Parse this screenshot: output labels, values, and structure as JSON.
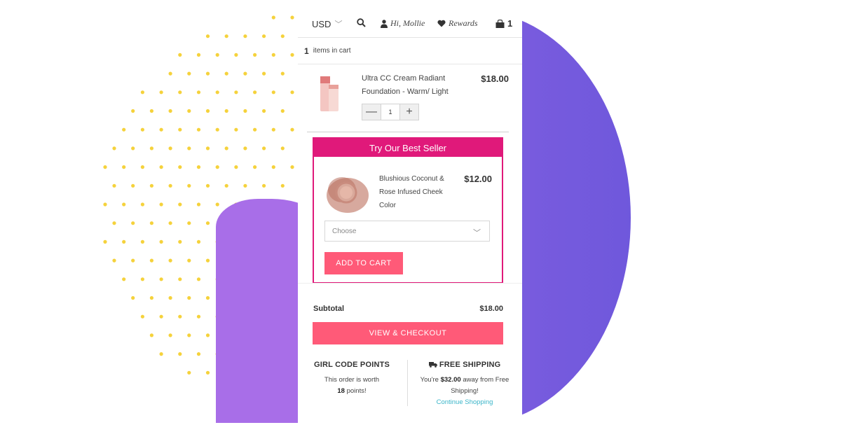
{
  "topbar": {
    "currency": "USD",
    "greeting": "Hi, Mollie",
    "rewards": "Rewards",
    "cart_count": "1"
  },
  "cart": {
    "count": "1",
    "count_label": "items in cart",
    "item": {
      "name": "Ultra CC Cream Radiant Foundation - Warm/ Light",
      "price": "$18.00",
      "quantity": "1"
    }
  },
  "best_seller": {
    "heading": "Try Our Best Seller",
    "product_name": "Blushious Coconut & Rose Infused Cheek Color",
    "price": "$12.00",
    "select_placeholder": "Choose",
    "add_button": "ADD TO CART"
  },
  "summary": {
    "subtotal_label": "Subtotal",
    "subtotal_value": "$18.00",
    "checkout_button": "VIEW & CHECKOUT"
  },
  "points": {
    "title": "GIRL CODE POINTS",
    "text_pre": "This order is worth",
    "points": "18",
    "text_post": "points!"
  },
  "shipping": {
    "title": "FREE SHIPPING",
    "text_pre": "You're",
    "amount": "$32.00",
    "text_post": "away from Free Shipping!",
    "link": "Continue Shopping"
  },
  "colors": {
    "accent_pink": "#ff5a78",
    "magenta": "#e0197a",
    "purple": "#7a5cde",
    "dot_yellow": "#f5d23c",
    "link_teal": "#3bb5c9"
  }
}
